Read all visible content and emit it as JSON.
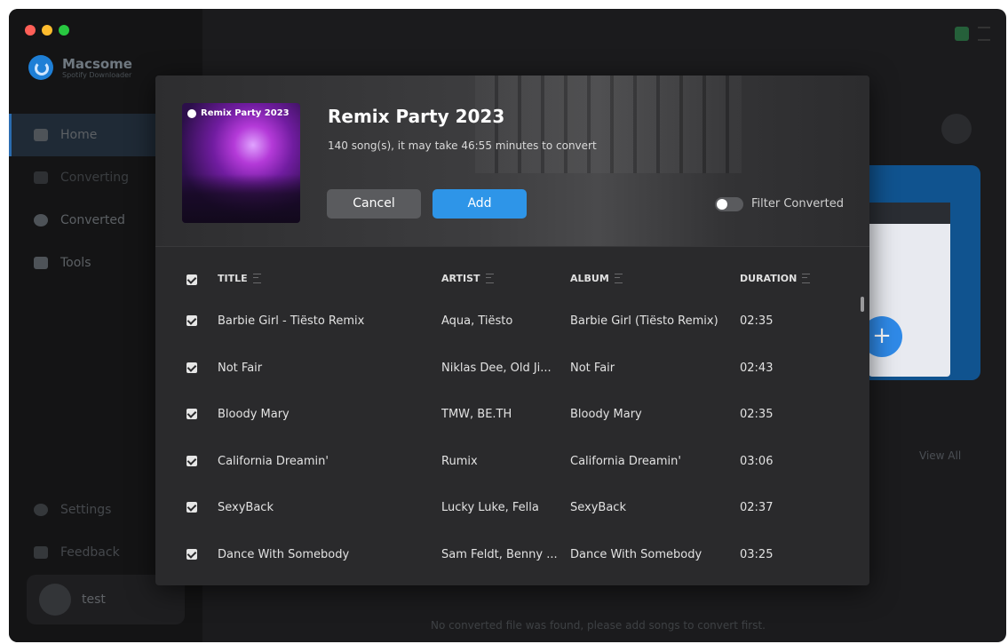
{
  "sidebar": {
    "app_name": "Macsome",
    "app_sub": "Spotify Downloader",
    "nav": [
      {
        "label": "Home"
      },
      {
        "label": "Converting"
      },
      {
        "label": "Converted"
      },
      {
        "label": "Tools"
      }
    ],
    "bottom": [
      {
        "label": "Settings"
      },
      {
        "label": "Feedback"
      }
    ],
    "user": "test"
  },
  "main": {
    "view_all": "View All",
    "empty_message": "No converted file was found, please add songs to convert first."
  },
  "modal": {
    "cover_text": "Remix Party 2023",
    "title": "Remix Party 2023",
    "subtitle": "140 song(s), it may take 46:55 minutes to convert",
    "cancel_label": "Cancel",
    "add_label": "Add",
    "filter_label": "Filter Converted",
    "filter_on": false,
    "columns": {
      "title": "TITLE",
      "artist": "ARTIST",
      "album": "ALBUM",
      "duration": "DURATION"
    },
    "rows": [
      {
        "title": "Barbie Girl - Tiësto Remix",
        "artist": "Aqua, Tiësto",
        "album": "Barbie Girl (Tiësto Remix)",
        "duration": "02:35",
        "checked": true
      },
      {
        "title": "Not Fair",
        "artist": "Niklas Dee, Old Ji...",
        "album": "Not Fair",
        "duration": "02:43",
        "checked": true
      },
      {
        "title": "Bloody Mary",
        "artist": "TMW, BE.TH",
        "album": "Bloody Mary",
        "duration": "02:35",
        "checked": true
      },
      {
        "title": "California Dreamin'",
        "artist": "Rumix",
        "album": "California Dreamin'",
        "duration": "03:06",
        "checked": true
      },
      {
        "title": "SexyBack",
        "artist": "Lucky Luke, Fella",
        "album": "SexyBack",
        "duration": "02:37",
        "checked": true
      },
      {
        "title": "Dance With Somebody",
        "artist": "Sam Feldt, Benny ...",
        "album": "Dance With Somebody",
        "duration": "03:25",
        "checked": true
      }
    ]
  },
  "colors": {
    "accent": "#2e95e8",
    "window_bg": "#1b1b1d",
    "modal_bg": "#2a2a2c",
    "traffic_red": "#ff5f57",
    "traffic_yellow": "#febc2e",
    "traffic_green": "#28c840"
  }
}
